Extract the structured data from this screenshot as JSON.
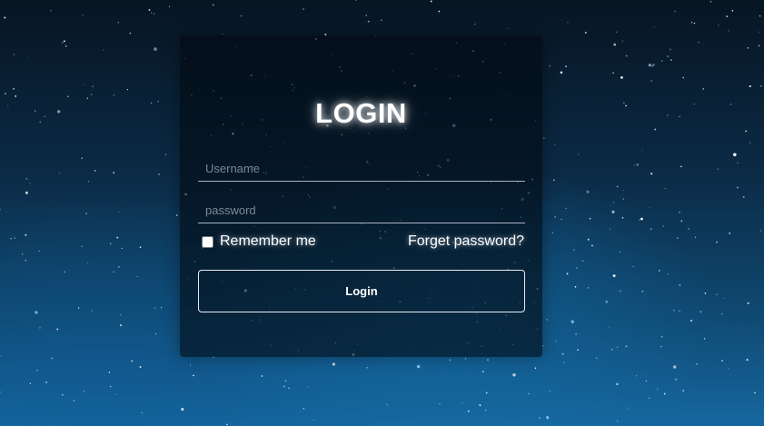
{
  "form": {
    "title": "LOGIN",
    "username_placeholder": "Username",
    "username_value": "",
    "password_placeholder": "password",
    "password_value": "",
    "remember_label": "Remember me",
    "remember_checked": false,
    "forget_label": "Forget password?",
    "login_label": "Login"
  },
  "colors": {
    "background_top": "#071522",
    "background_bottom": "#1667a0",
    "card_background": "rgba(2,10,18,0.62)",
    "text": "#ffffff"
  }
}
